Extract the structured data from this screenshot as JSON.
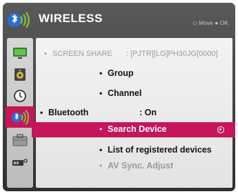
{
  "header": {
    "title": "WIRELESS",
    "hint": "◇ Move ● OK"
  },
  "sidebar": {
    "items": [
      {
        "icon": "tv-picture-icon"
      },
      {
        "icon": "speaker-audio-icon"
      },
      {
        "icon": "clock-time-icon"
      },
      {
        "icon": "bluetooth-wireless-icon",
        "active": true
      },
      {
        "icon": "toolbox-option-icon"
      },
      {
        "icon": "input-device-icon"
      }
    ]
  },
  "menu": {
    "screen_share": {
      "label": "SCREEN SHARE",
      "value": ": [PJTR][LG]PH30JG[0000]"
    },
    "group": {
      "label": "Group"
    },
    "channel": {
      "label": "Channel"
    },
    "bluetooth": {
      "label": "Bluetooth",
      "value": ": On"
    },
    "search_device": {
      "label": "Search Device"
    },
    "registered": {
      "label": "List of registered devices"
    },
    "av_sync": {
      "label": "AV Sync. Adjust"
    }
  },
  "bullet": "•",
  "colors": {
    "accent": "#c5165a",
    "frame": "#3a3a3a"
  }
}
